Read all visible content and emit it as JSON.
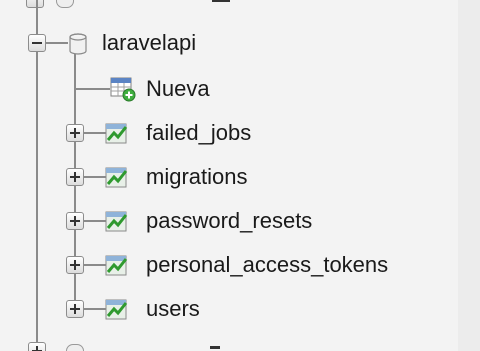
{
  "tree": {
    "database": {
      "name": "laravelapi",
      "expanded": true,
      "icon": "database-icon"
    },
    "new_item": {
      "label": "Nueva",
      "icon": "new-table-icon"
    },
    "tables": [
      {
        "name": "failed_jobs",
        "icon": "table-icon"
      },
      {
        "name": "migrations",
        "icon": "table-icon"
      },
      {
        "name": "password_resets",
        "icon": "table-icon"
      },
      {
        "name": "personal_access_tokens",
        "icon": "table-icon"
      },
      {
        "name": "users",
        "icon": "table-icon"
      }
    ]
  }
}
